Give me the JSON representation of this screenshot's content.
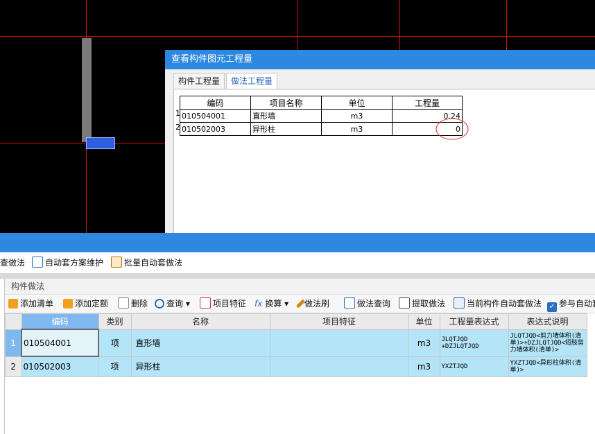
{
  "dialog": {
    "title": "查看构件图元工程量",
    "tabs": [
      "构件工程量",
      "做法工程量"
    ],
    "table": {
      "headers": [
        "编码",
        "项目名称",
        "单位",
        "工程量"
      ],
      "rows": [
        {
          "no": "1",
          "code": "010504001",
          "name": "直形墙",
          "unit": "m3",
          "qty": "0.24"
        },
        {
          "no": "2",
          "code": "010502003",
          "name": "异形柱",
          "unit": "m3",
          "qty": "0"
        }
      ]
    }
  },
  "toolbar1": {
    "items": [
      "查做法",
      "自动套方案维护",
      "批量自动套做法"
    ]
  },
  "panel": {
    "title": "构件做法",
    "toolbar": [
      "添加清单",
      "添加定额",
      "删除",
      "查询",
      "项目特征",
      "换算",
      "做法刷",
      "做法查询",
      "提取做法",
      "当前构件自动套做法",
      "参与自动套"
    ],
    "headers": [
      "编码",
      "类别",
      "名称",
      "项目特征",
      "单位",
      "工程量表达式",
      "表达式说明"
    ],
    "rows": [
      {
        "no": "1",
        "code": "010504001",
        "type": "项",
        "name": "直形墙",
        "feature": "",
        "unit": "m3",
        "expr": "JLQTJQD\n+DZJLQTJQD",
        "desc": "JLQTJQD<剪力墙体积(清单)>+DZJLQTJQD<短肢剪力墙体积(清单)>"
      },
      {
        "no": "2",
        "code": "010502003",
        "type": "项",
        "name": "异形柱",
        "feature": "",
        "unit": "m3",
        "expr": "YXZTJQD",
        "desc": "YXZTJQD<异形柱体积(清单)>"
      }
    ]
  },
  "colors": {
    "accent": "#2d88e0",
    "highlight": "#b3e4f7",
    "cad_line": "#d01010"
  }
}
